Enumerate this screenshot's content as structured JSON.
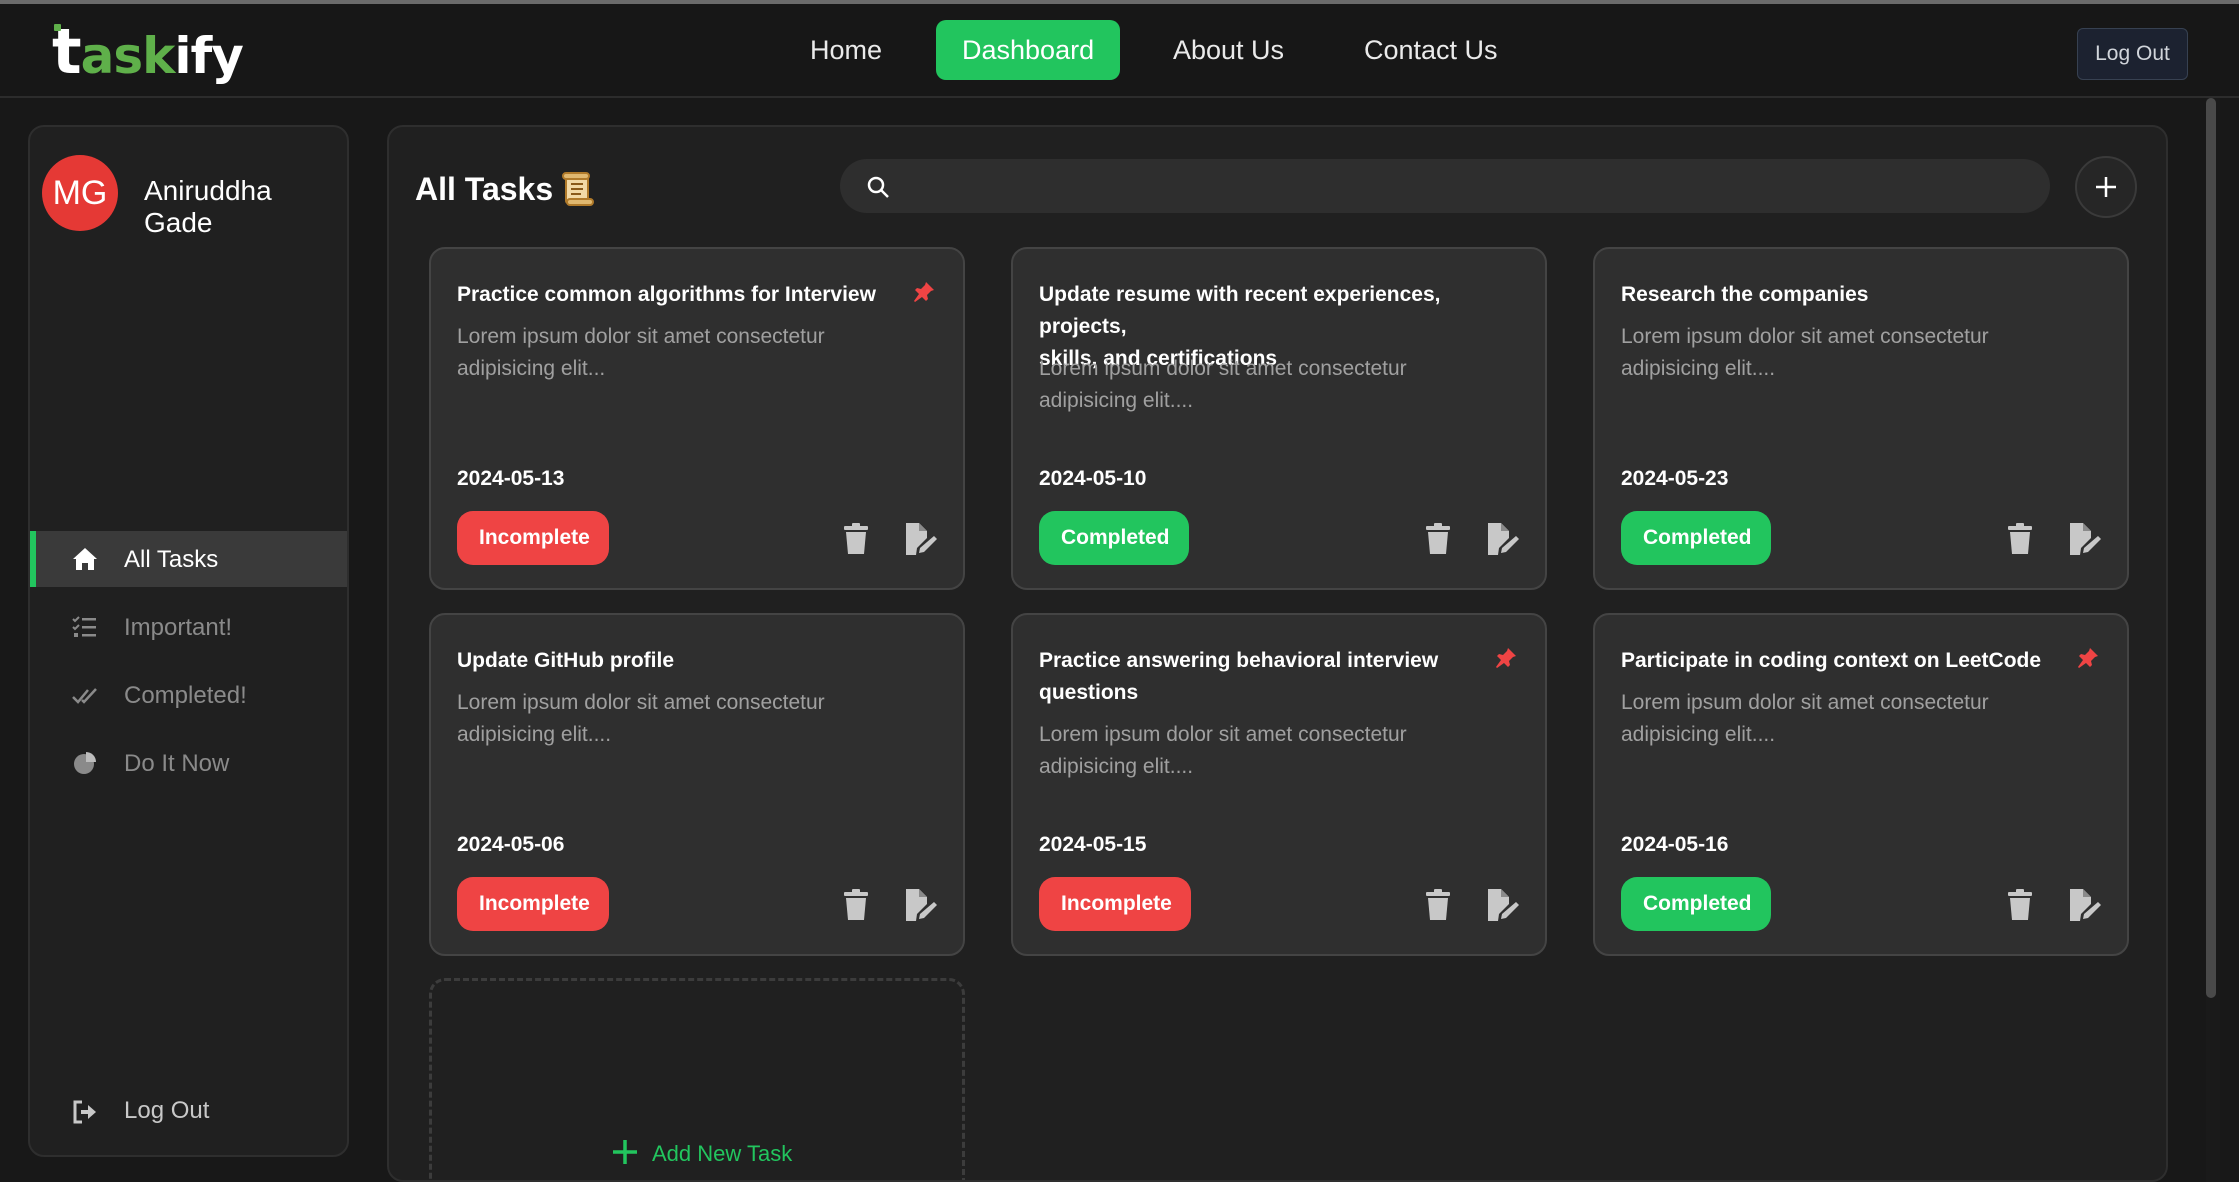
{
  "app": {
    "logo_parts": [
      "t",
      "ask",
      "ify"
    ],
    "brand_color": "#5fb04a",
    "accent_color": "#22c55e"
  },
  "nav": {
    "items": [
      {
        "label": "Home",
        "active": false
      },
      {
        "label": "Dashboard",
        "active": true
      },
      {
        "label": "About Us",
        "active": false
      },
      {
        "label": "Contact Us",
        "active": false
      }
    ],
    "logout_label": "Log Out"
  },
  "sidebar": {
    "avatar_initials": "MG",
    "avatar_color": "#e53935",
    "username": "Aniruddha Gade",
    "items": [
      {
        "label": "All Tasks",
        "icon": "home-icon",
        "active": true
      },
      {
        "label": "Important!",
        "icon": "list-check-icon",
        "active": false
      },
      {
        "label": "Completed!",
        "icon": "double-check-icon",
        "active": false
      },
      {
        "label": "Do It Now",
        "icon": "pie-chart-icon",
        "active": false
      }
    ],
    "logout_label": "Log Out"
  },
  "main": {
    "title": "All Tasks",
    "title_icon": "scroll-icon",
    "search": {
      "placeholder": "",
      "value": ""
    },
    "add_button_icon": "plus-icon",
    "add_new_task_label": "Add New Task",
    "tasks": [
      {
        "title": "Practice common algorithms for Interview",
        "desc_lines": [
          "Lorem ipsum dolor sit amet consectetur",
          "adipisicing elit..."
        ],
        "date": "2024-05-13",
        "status": "Incomplete",
        "pinned": true
      },
      {
        "title_lines": [
          "Update resume with recent experiences, projects,",
          "skills, and certifications"
        ],
        "desc_lines": [
          "Lorem ipsum dolor sit amet consectetur",
          "adipisicing elit...."
        ],
        "date": "2024-05-10",
        "status": "Completed",
        "pinned": false
      },
      {
        "title": "Research the companies",
        "desc_lines": [
          "Lorem ipsum dolor sit amet consectetur",
          "adipisicing elit...."
        ],
        "date": "2024-05-23",
        "status": "Completed",
        "pinned": false
      },
      {
        "title": "Update GitHub profile",
        "desc_lines": [
          "Lorem ipsum dolor sit amet consectetur",
          "adipisicing elit...."
        ],
        "date": "2024-05-06",
        "status": "Incomplete",
        "pinned": false
      },
      {
        "title_lines": [
          "Practice answering behavioral interview",
          "questions"
        ],
        "desc_lines": [
          "Lorem ipsum dolor sit amet consectetur",
          "adipisicing elit...."
        ],
        "date": "2024-05-15",
        "status": "Incomplete",
        "pinned": true
      },
      {
        "title": "Participate in coding context on LeetCode",
        "desc_lines": [
          "Lorem ipsum dolor sit amet consectetur",
          "adipisicing elit...."
        ],
        "date": "2024-05-16",
        "status": "Completed",
        "pinned": true
      }
    ]
  },
  "colors": {
    "incomplete": "#ef4444",
    "completed": "#22c55e",
    "pin": "#ef4444"
  }
}
